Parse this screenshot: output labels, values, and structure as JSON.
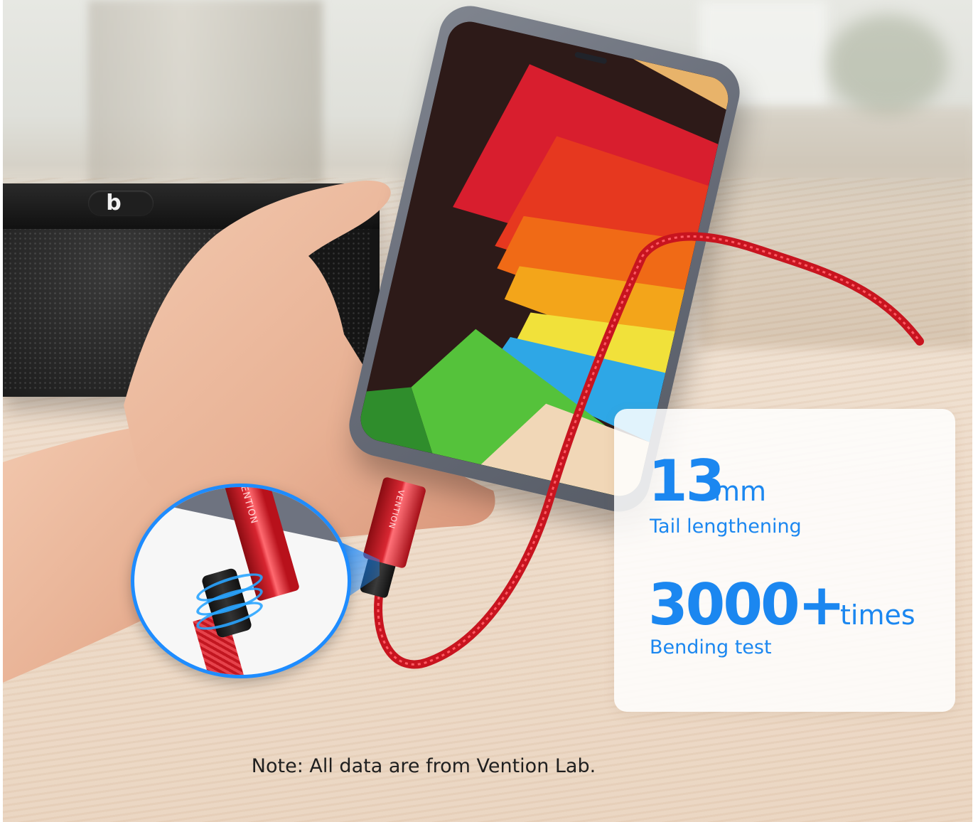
{
  "scene": {
    "speaker_logo": "b",
    "brand_on_connector": "VENTION",
    "colors": {
      "accent_blue": "#1b87f0",
      "cable_red": "#d92732",
      "phone_gray": "#6e7380"
    }
  },
  "stats": {
    "length_value": "13",
    "length_unit": "mm",
    "length_label": "Tail lengthening",
    "bend_value": "3000+",
    "bend_unit": "times",
    "bend_label": "Bending test"
  },
  "footer": {
    "note": "Note: All data are from Vention Lab."
  }
}
